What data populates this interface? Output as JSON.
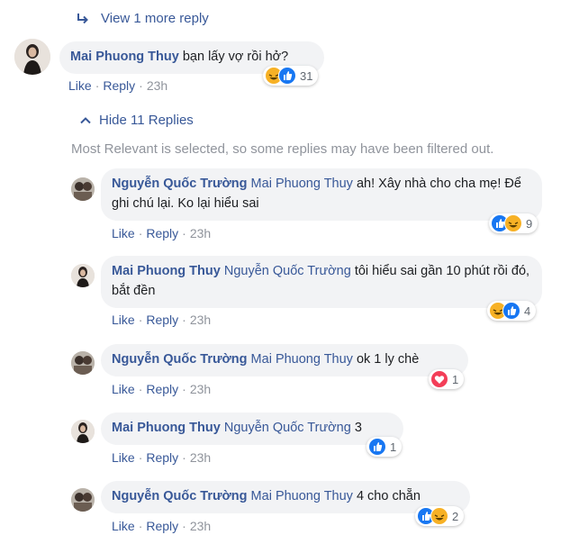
{
  "top_link": {
    "label": "View 1 more reply"
  },
  "main_comment": {
    "author": "Mai Phuong Thuy",
    "text": "bạn lấy vợ rồi hở?",
    "reaction_count": "31",
    "actions": {
      "like": "Like",
      "reply": "Reply",
      "time": "23h"
    }
  },
  "replies_toggle": {
    "label": "Hide 11 Replies"
  },
  "filter_note": "Most Relevant is selected, so some replies may have been filtered out.",
  "replies": [
    {
      "author": "Nguyễn Quốc Trường",
      "mention": "Mai Phuong Thuy",
      "text": "ah! Xây nhà cho cha mẹ! Để ghi chú lại. Ko lại hiểu sai",
      "reaction_count": "9",
      "actions": {
        "like": "Like",
        "reply": "Reply",
        "time": "23h"
      }
    },
    {
      "author": "Mai Phuong Thuy",
      "mention": "Nguyễn Quốc Trường",
      "text": "tôi hiểu sai gần 10 phút rồi đó, bắt đền",
      "reaction_count": "4",
      "actions": {
        "like": "Like",
        "reply": "Reply",
        "time": "23h"
      }
    },
    {
      "author": "Nguyễn Quốc Trường",
      "mention": "Mai Phuong Thuy",
      "text": "ok 1 ly chè",
      "reaction_count": "1",
      "actions": {
        "like": "Like",
        "reply": "Reply",
        "time": "23h"
      }
    },
    {
      "author": "Mai Phuong Thuy",
      "mention": "Nguyễn Quốc Trường",
      "text": "3",
      "reaction_count": "1",
      "actions": {
        "like": "Like",
        "reply": "Reply",
        "time": "23h"
      }
    },
    {
      "author": "Nguyễn Quốc Trường",
      "mention": "Mai Phuong Thuy",
      "text": "4 cho chẵn",
      "reaction_count": "2",
      "actions": {
        "like": "Like",
        "reply": "Reply",
        "time": "23h"
      }
    }
  ],
  "colors": {
    "link": "#385898",
    "bubble": "#f2f3f5",
    "muted": "#90949c",
    "like": "#1877f2",
    "haha": "#f7b125",
    "love": "#f33e58"
  },
  "icons": [
    "reply-arrow-icon",
    "chevron-up-icon",
    "like-reaction-icon",
    "haha-reaction-icon",
    "love-reaction-icon"
  ]
}
